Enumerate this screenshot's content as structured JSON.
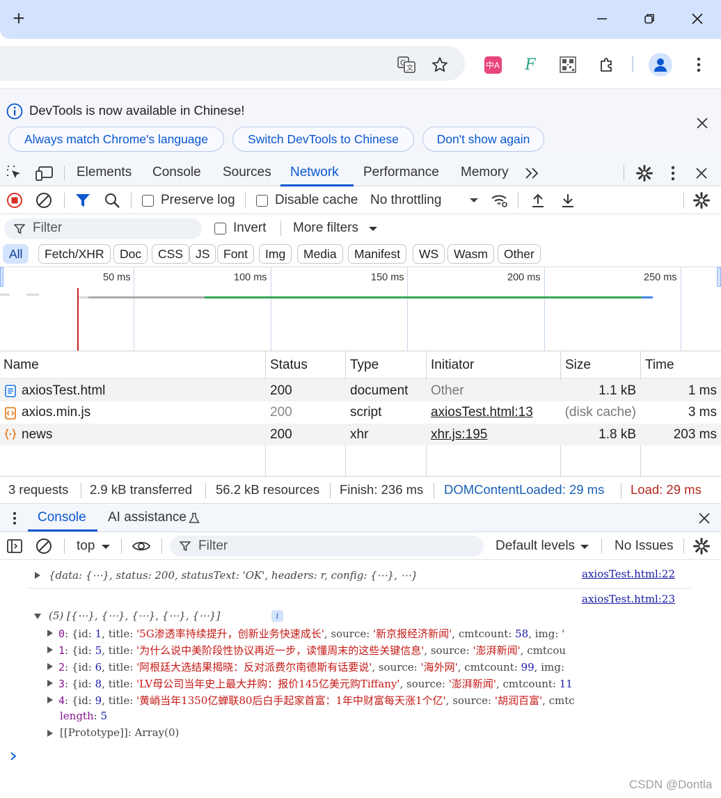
{
  "browser": {
    "new_tab": "+"
  },
  "infobar": {
    "message": "DevTools is now available in Chinese!",
    "btn1": "Always match Chrome's language",
    "btn2": "Switch DevTools to Chinese",
    "btn3": "Don't show again"
  },
  "tabs": [
    "Elements",
    "Console",
    "Sources",
    "Network",
    "Performance",
    "Memory"
  ],
  "toolbar": {
    "preserve_log": "Preserve log",
    "disable_cache": "Disable cache",
    "throttling": "No throttling"
  },
  "filter": {
    "placeholder": "Filter",
    "invert": "Invert",
    "more_filters": "More filters"
  },
  "chips": [
    "All",
    "Fetch/XHR",
    "Doc",
    "CSS",
    "JS",
    "Font",
    "Img",
    "Media",
    "Manifest",
    "WS",
    "Wasm",
    "Other"
  ],
  "timeline": {
    "ticks": [
      "50 ms",
      "100 ms",
      "150 ms",
      "200 ms",
      "250 ms"
    ]
  },
  "table": {
    "headers": [
      "Name",
      "Status",
      "Type",
      "Initiator",
      "Size",
      "Time"
    ],
    "rows": [
      {
        "name": "axiosTest.html",
        "status": "200",
        "type": "document",
        "initiator": "Other",
        "size": "1.1 kB",
        "time": "1 ms"
      },
      {
        "name": "axios.min.js",
        "status": "200",
        "type": "script",
        "initiator": "axiosTest.html:13",
        "size": "(disk cache)",
        "time": "3 ms"
      },
      {
        "name": "news",
        "status": "200",
        "type": "xhr",
        "initiator": "xhr.js:195",
        "size": "1.8 kB",
        "time": "203 ms"
      }
    ]
  },
  "summary": {
    "requests": "3 requests",
    "transferred": "2.9 kB transferred",
    "resources": "56.2 kB resources",
    "finish": "Finish: 236 ms",
    "dcl": "DOMContentLoaded: 29 ms",
    "load": "Load: 29 ms"
  },
  "drawer": {
    "tab_console": "Console",
    "tab_ai": "AI assistance",
    "context": "top",
    "filter": "Filter",
    "levels": "Default levels",
    "issues": "No Issues"
  },
  "console": {
    "line1": "{data: {⋯}, status: 200, statusText: 'OK', headers: r, config: {⋯},  ⋯}",
    "line1_src": "axiosTest.html:22",
    "line2_src": "axiosTest.html:23",
    "array_head": "(5)  [{⋯}, {⋯}, {⋯}, {⋯}, {⋯}]",
    "items": [
      {
        "idx": "0",
        "id": "1",
        "title": "'5G渗透率持续提升，创新业务快速成长'",
        "source": "'新京报经济新闻'",
        "cmt": "58",
        "tail": ", img: '"
      },
      {
        "idx": "1",
        "id": "5",
        "title": "'为什么说中美阶段性协议再近一步，读懂周末的这些关键信息'",
        "source": "'澎湃新闻'",
        "cmt": "",
        "tail": ", cmtcou"
      },
      {
        "idx": "2",
        "id": "6",
        "title": "'阿根廷大选结果揭晓：反对派费尔南德斯有话要说'",
        "source": "'海外网'",
        "cmt": "99",
        "tail": ", img:"
      },
      {
        "idx": "3",
        "id": "8",
        "title": "'LV母公司当年史上最大并购：报价145亿美元购Tiffany'",
        "source": "'澎湃新闻'",
        "cmt": "11",
        "tail": ""
      },
      {
        "idx": "4",
        "id": "9",
        "title": "'黄峭当年1350亿蝉联80后白手起家首富：1年中财富每天涨1个亿'",
        "source": "'胡润百富'",
        "cmt": "",
        "tail": ", cmtc"
      }
    ],
    "length_label": "length",
    "length_val": "5",
    "proto": "[[Prototype]]: Array(0)"
  },
  "watermark": "CSDN @Dontla"
}
